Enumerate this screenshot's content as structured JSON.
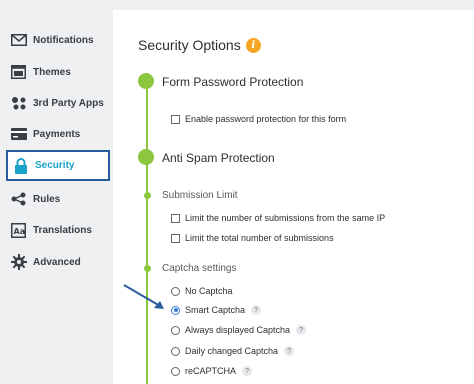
{
  "sidebar": {
    "items": [
      {
        "label": "Notifications",
        "icon": "envelope-icon"
      },
      {
        "label": "Themes",
        "icon": "window-icon"
      },
      {
        "label": "3rd Party Apps",
        "icon": "apps-icon"
      },
      {
        "label": "Payments",
        "icon": "card-icon"
      },
      {
        "label": "Security",
        "icon": "lock-icon",
        "active": true
      },
      {
        "label": "Rules",
        "icon": "rules-icon"
      },
      {
        "label": "Translations",
        "icon": "translate-icon"
      },
      {
        "label": "Advanced",
        "icon": "gear-icon"
      }
    ]
  },
  "main": {
    "title": "Security Options",
    "info_icon": "i",
    "form_password": {
      "title": "Form Password Protection",
      "option": "Enable password protection for this form"
    },
    "anti_spam": {
      "title": "Anti Spam Protection",
      "submission_limit": {
        "title": "Submission Limit",
        "options": [
          "Limit the number of submissions from the same IP",
          "Limit the total number of submissions"
        ]
      },
      "captcha": {
        "title": "Captcha settings",
        "options": [
          {
            "label": "No Captcha",
            "checked": false,
            "help": false
          },
          {
            "label": "Smart Captcha",
            "checked": true,
            "help": true
          },
          {
            "label": "Always displayed Captcha",
            "checked": false,
            "help": true
          },
          {
            "label": "Daily changed Captcha",
            "checked": false,
            "help": true
          },
          {
            "label": "reCAPTCHA",
            "checked": false,
            "help": true
          }
        ],
        "help_symbol": "?"
      }
    }
  },
  "colors": {
    "accent_green": "#8cc63f",
    "active_border": "#2a5b9a",
    "active_text": "#1aa3c8",
    "info_orange": "#f5a623",
    "arrow_blue": "#2a5b9a"
  }
}
